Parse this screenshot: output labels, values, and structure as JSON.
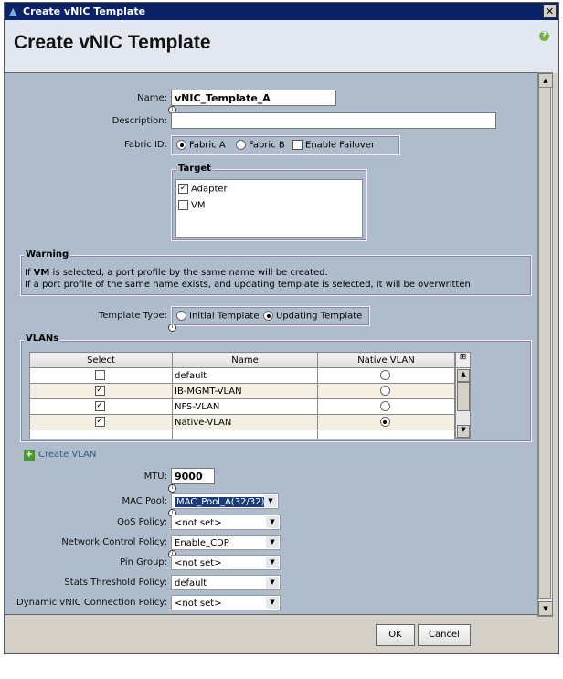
{
  "window": {
    "title": "Create vNIC Template",
    "close": "✕"
  },
  "header": {
    "title": "Create vNIC Template",
    "help": "?"
  },
  "form": {
    "name_label": "Name:",
    "name_value": "vNIC_Template_A",
    "description_label": "Description:",
    "description_value": "",
    "fabric_label": "Fabric ID:",
    "fabric_a": "Fabric A",
    "fabric_b": "Fabric B",
    "failover": "Enable Failover",
    "target_title": "Target",
    "target_adapter": "Adapter",
    "target_vm": "VM",
    "warning_title": "Warning",
    "warning_line1_pre": "If ",
    "warning_line1_bold": "VM",
    "warning_line1_post": " is selected, a port profile by the same name will be created.",
    "warning_line2": "If a port profile of the same name exists, and updating template is selected, it will be overwritten",
    "template_type_label": "Template Type:",
    "initial": "Initial Template",
    "updating": "Updating Template",
    "vlans_title": "VLANs",
    "vlan_columns": [
      "Select",
      "Name",
      "Native VLAN"
    ],
    "vlans": [
      {
        "name": "default",
        "selected": false,
        "native": false
      },
      {
        "name": "IB-MGMT-VLAN",
        "selected": true,
        "native": false
      },
      {
        "name": "NFS-VLAN",
        "selected": true,
        "native": false
      },
      {
        "name": "Native-VLAN",
        "selected": true,
        "native": true
      }
    ],
    "create_vlan": "Create VLAN",
    "mtu_label": "MTU:",
    "mtu_value": "9000",
    "mac_pool_label": "MAC Pool:",
    "mac_pool_value": "MAC_Pool_A(32/32)",
    "qos_label": "QoS Policy:",
    "qos_value": "<not set>",
    "ncp_label": "Network Control Policy:",
    "ncp_value": "Enable_CDP",
    "pin_label": "Pin Group:",
    "pin_value": "<not set>",
    "stats_label": "Stats Threshold Policy:",
    "stats_value": "default",
    "dyn_label": "Dynamic vNIC Connection Policy:",
    "dyn_value": "<not set>"
  },
  "buttons": {
    "ok": "OK",
    "cancel": "Cancel"
  }
}
